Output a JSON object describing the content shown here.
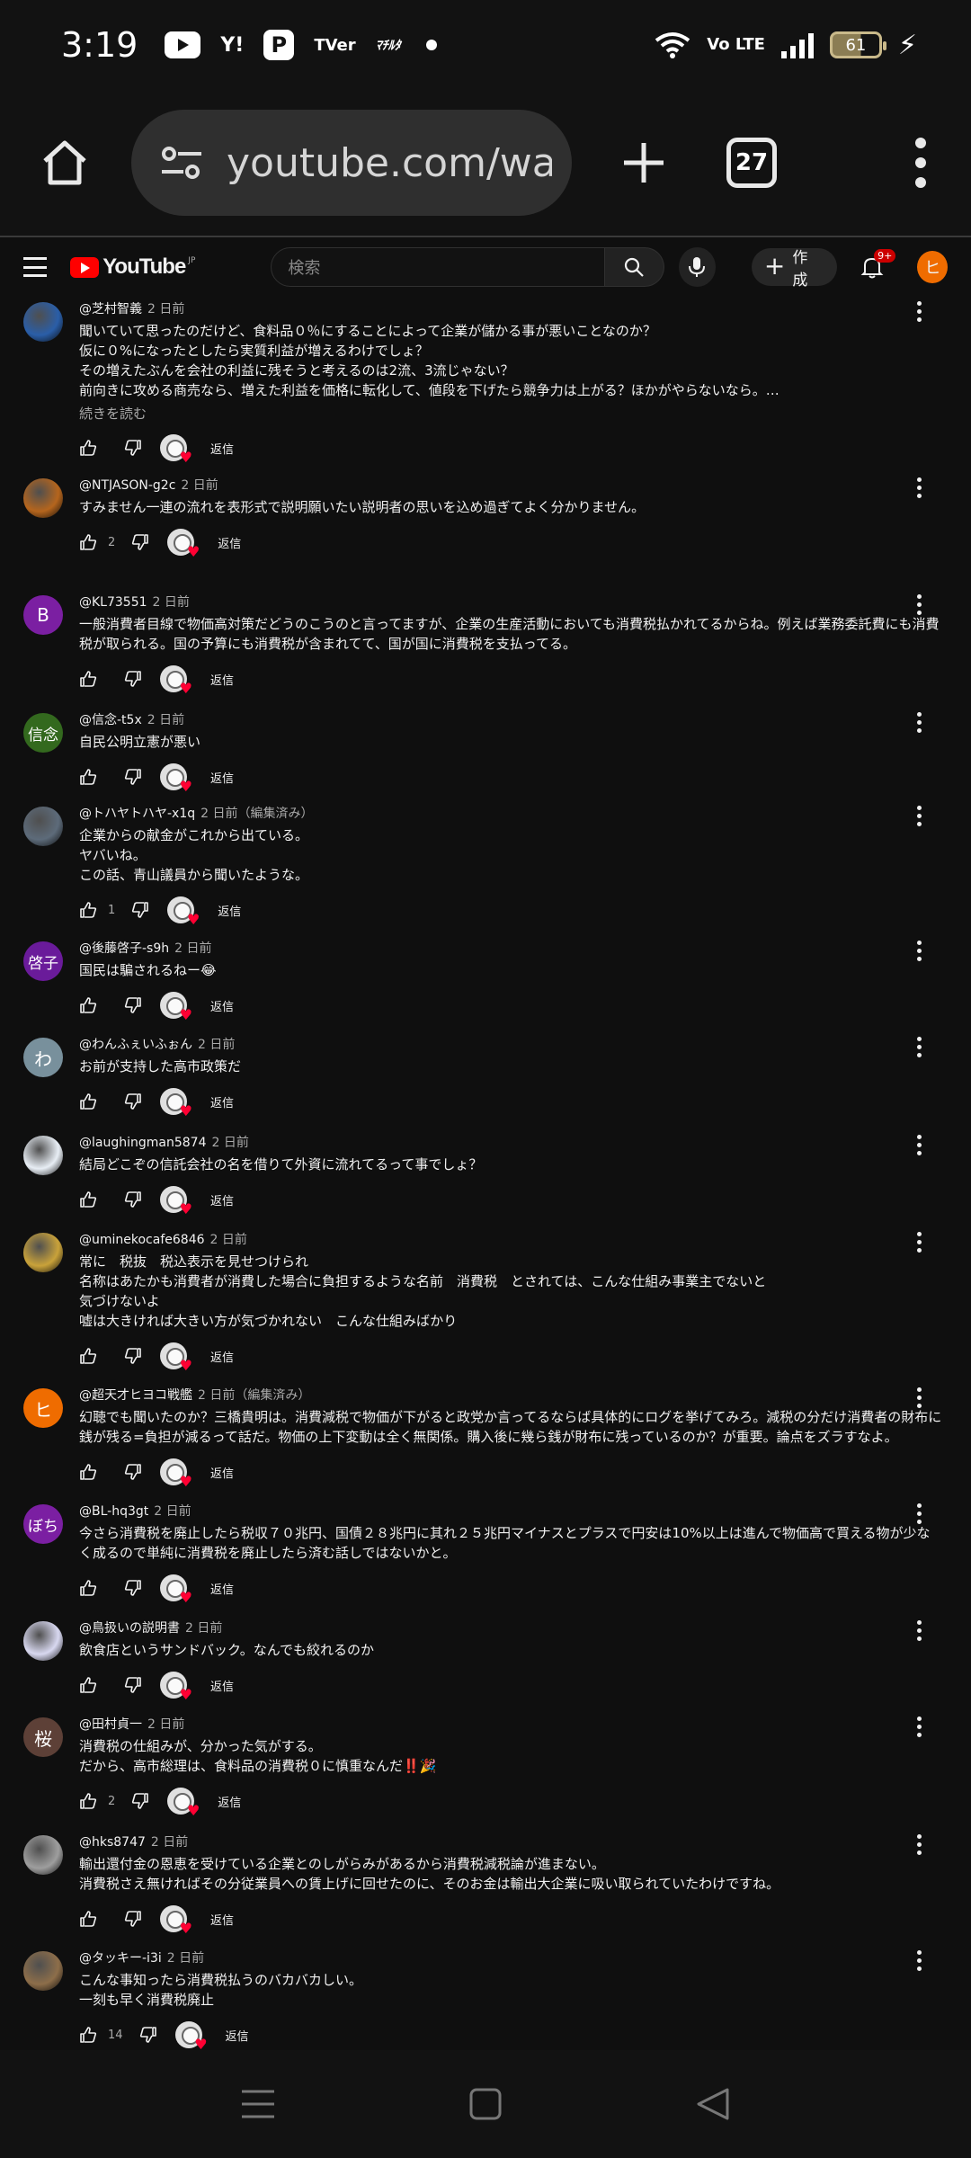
{
  "status_bar": {
    "time": "3:19",
    "notification_icons": [
      "youtube-icon",
      "yahoo-icon",
      "p-app-icon",
      "tver-icon",
      "app-logo-icon",
      "dot-icon"
    ],
    "yahoo_label": "Y!",
    "p_label": "P",
    "tver_label": "TVer",
    "app_logo_label": "ﾏﾁﾙﾀ",
    "volte_label": "Vo LTE",
    "battery": "61"
  },
  "browser": {
    "url": "youtube.com/wat",
    "tab_count": "27"
  },
  "yt_header": {
    "logo_text": "YouTube",
    "logo_region": "JP",
    "search_placeholder": "検索",
    "create_label": "作成",
    "notif_badge": "9+",
    "user_initial": "ヒ"
  },
  "comments": [
    {
      "author": "@芝村智義",
      "time": "2 日前",
      "avatar": {
        "type": "image",
        "color": "#2a5ea8"
      },
      "text": "聞いていて思ったのだけど、食料品０％にすることによって企業が儲かる事が悪いことなのか？\n仮に０%になったとしたら実質利益が増えるわけでしょ？\nその増えたぶんを会社の利益に残そうと考えるのは2流、3流じゃない？\n前向きに攻める商売なら、増えた利益を価格に転化して、値段を下げたら競争力は上がる？ほかがやらないなら。…",
      "more": "続きを読む",
      "likes": ""
    },
    {
      "author": "@NTJASON-g2c",
      "time": "2 日前",
      "avatar": {
        "type": "image",
        "color": "#b5651d"
      },
      "text": "すみません一連の流れを表形式で説明願いたい説明者の思いを込め過ぎてよく分かりません。",
      "likes": "2"
    },
    {
      "author": "@KL73551",
      "time": "2 日前",
      "avatar": {
        "type": "initial",
        "initial": "B",
        "color": "#7b1fa2"
      },
      "text": "一般消費者目線で物価高対策だどうのこうのと言ってますが、企業の生産活動においても消費税払かれてるからね。例えば業務委託費にも消費税が取られる。国の予算にも消費税が含まれてて、国が国に消費税を支払ってる。",
      "likes": ""
    },
    {
      "author": "@信念-t5x",
      "time": "2 日前",
      "avatar": {
        "type": "initial",
        "initial": "信念",
        "color": "#33691e"
      },
      "text": "自民公明立憲が悪い",
      "likes": ""
    },
    {
      "author": "@トハヤトハヤ-x1q",
      "time": "2 日前（編集済み）",
      "avatar": {
        "type": "image",
        "color": "#5d6b7a"
      },
      "text": "企業からの献金がこれから出ている。\nヤバいね。\nこの話、青山議員から聞いたような。",
      "likes": "1"
    },
    {
      "author": "@後藤啓子-s9h",
      "time": "2 日前",
      "avatar": {
        "type": "initial",
        "initial": "啓子",
        "color": "#6a1b9a"
      },
      "text": "国民は騙されるねー😂",
      "likes": ""
    },
    {
      "author": "@わんふぇいふぉん",
      "time": "2 日前",
      "avatar": {
        "type": "initial",
        "initial": "わ",
        "color": "#78909c"
      },
      "text": "お前が支持した高市政策だ",
      "likes": ""
    },
    {
      "author": "@laughingman5874",
      "time": "2 日前",
      "avatar": {
        "type": "image",
        "color": "#e8eef5"
      },
      "text": "結局どこぞの信託会社の名を借りて外資に流れてるって事でしょ？",
      "likes": ""
    },
    {
      "author": "@uminekocafe6846",
      "time": "2 日前",
      "avatar": {
        "type": "image",
        "color": "#c9a23a"
      },
      "text": "常に　税抜　税込表示を見せつけられ\n名称はあたかも消費者が消費した場合に負担するような名前　消費税　とされては、こんな仕組み事業主でないと\n気づけないよ\n嘘は大きければ大きい方が気づかれない　こんな仕組みばかり",
      "likes": ""
    },
    {
      "author": "@超天才ヒヨコ戦艦",
      "time": "2 日前（編集済み）",
      "avatar": {
        "type": "initial",
        "initial": "ヒ",
        "color": "#ef6c00"
      },
      "text": "幻聴でも聞いたのか？三橋貴明は。消費減税で物価が下がると政党か言ってるならば具体的にログを挙げてみろ。減税の分だけ消費者の財布に銭が残る=負担が減るって話だ。物価の上下変動は全く無関係。購入後に幾ら銭が財布に残っているのか？が重要。論点をズラすなよ。",
      "likes": ""
    },
    {
      "author": "@BL-hq3gt",
      "time": "2 日前",
      "avatar": {
        "type": "initial",
        "initial": "ぼち",
        "color": "#7b1fa2"
      },
      "text": "今さら消費税を廃止したら税収７０兆円、国債２８兆円に其れ２５兆円マイナスとプラスで円安は10%以上は進んで物価高で買える物が少なく成るので単純に消費税を廃止したら済む話しではないかと。",
      "likes": ""
    },
    {
      "author": "@鳥扱いの説明書",
      "time": "2 日前",
      "avatar": {
        "type": "image",
        "color": "#d8d8f0"
      },
      "text": "飲食店というサンドバック。なんでも絞れるのか",
      "likes": ""
    },
    {
      "author": "@田村貞一",
      "time": "2 日前",
      "avatar": {
        "type": "initial",
        "initial": "桜",
        "color": "#5d4037"
      },
      "text": "消費税の仕組みが、分かった気がする。\nだから、高市総理は、食料品の消費税０に慎重なんだ‼️🎉",
      "likes": "2"
    },
    {
      "author": "@hks8747",
      "time": "2 日前",
      "avatar": {
        "type": "image",
        "color": "#9e9e9e"
      },
      "text": "輸出還付金の恩恵を受けている企業とのしがらみがあるから消費税減税論が進まない。\n消費税さえ無ければその分従業員への賃上げに回せたのに、そのお金は輸出大企業に吸い取られていたわけですね。",
      "likes": ""
    },
    {
      "author": "@タッキー-i3i",
      "time": "2 日前",
      "avatar": {
        "type": "image",
        "color": "#8d6e4a"
      },
      "text": "こんな事知ったら消費税払うのバカバカしい。\n一刻も早く消費税廃止",
      "likes": "14"
    }
  ],
  "reply_label": "返信"
}
